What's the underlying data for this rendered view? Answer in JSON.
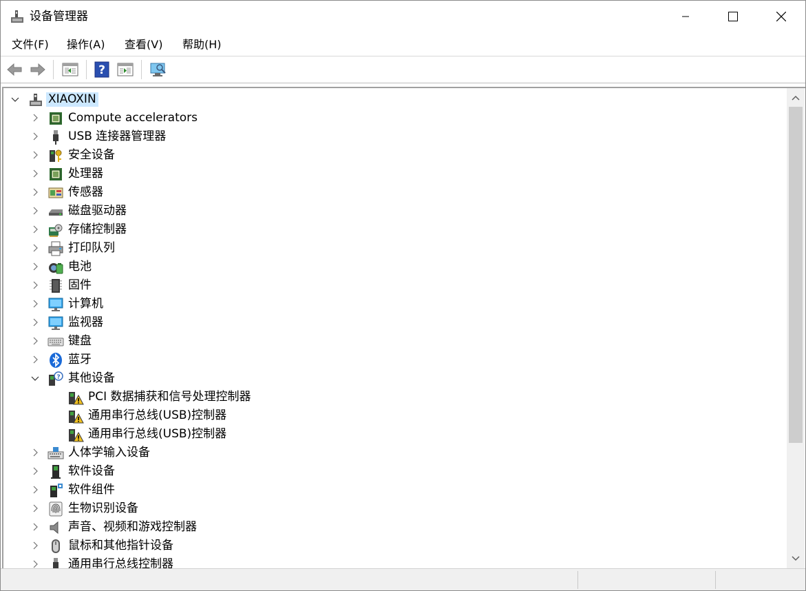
{
  "window": {
    "title": "设备管理器",
    "controls": [
      "minimize",
      "maximize",
      "close"
    ]
  },
  "menubar": {
    "items": [
      "文件(F)",
      "操作(A)",
      "查看(V)",
      "帮助(H)"
    ]
  },
  "toolbar": {
    "buttons": [
      "back-icon",
      "forward-icon",
      "properties-view-icon",
      "help-icon",
      "show-hide-icon",
      "scan-hardware-icon"
    ]
  },
  "tree": {
    "root": "XIAOXIN",
    "items": [
      {
        "label": "Compute accelerators",
        "icon": "chip-icon",
        "expanded": false
      },
      {
        "label": "USB 连接器管理器",
        "icon": "usb-plug-icon",
        "expanded": false
      },
      {
        "label": "安全设备",
        "icon": "security-key-icon",
        "expanded": false
      },
      {
        "label": "处理器",
        "icon": "processor-icon",
        "expanded": false
      },
      {
        "label": "传感器",
        "icon": "sensor-icon",
        "expanded": false
      },
      {
        "label": "磁盘驱动器",
        "icon": "disk-drive-icon",
        "expanded": false
      },
      {
        "label": "存储控制器",
        "icon": "storage-controller-icon",
        "expanded": false
      },
      {
        "label": "打印队列",
        "icon": "printer-icon",
        "expanded": false
      },
      {
        "label": "电池",
        "icon": "battery-icon",
        "expanded": false
      },
      {
        "label": "固件",
        "icon": "firmware-icon",
        "expanded": false
      },
      {
        "label": "计算机",
        "icon": "computer-icon",
        "expanded": false
      },
      {
        "label": "监视器",
        "icon": "monitor-icon",
        "expanded": false
      },
      {
        "label": "键盘",
        "icon": "keyboard-icon",
        "expanded": false
      },
      {
        "label": "蓝牙",
        "icon": "bluetooth-icon",
        "expanded": false
      },
      {
        "label": "其他设备",
        "icon": "other-devices-icon",
        "expanded": true,
        "children": [
          {
            "label": "PCI 数据捕获和信号处理控制器",
            "icon": "warning-device-icon"
          },
          {
            "label": "通用串行总线(USB)控制器",
            "icon": "warning-device-icon"
          },
          {
            "label": "通用串行总线(USB)控制器",
            "icon": "warning-device-icon"
          }
        ]
      },
      {
        "label": "人体学输入设备",
        "icon": "hid-icon",
        "expanded": false
      },
      {
        "label": "软件设备",
        "icon": "software-device-icon",
        "expanded": false
      },
      {
        "label": "软件组件",
        "icon": "software-component-icon",
        "expanded": false
      },
      {
        "label": "生物识别设备",
        "icon": "fingerprint-icon",
        "expanded": false
      },
      {
        "label": "声音、视频和游戏控制器",
        "icon": "speaker-icon",
        "expanded": false
      },
      {
        "label": "鼠标和其他指针设备",
        "icon": "mouse-icon",
        "expanded": false
      },
      {
        "label": "通用串行总线控制器",
        "icon": "usb-icon",
        "expanded": false
      }
    ]
  },
  "colors": {
    "selection": "#cce8ff",
    "scrollbar_track": "#f0f0f0",
    "scrollbar_thumb": "#cdcdcd",
    "status_bar": "#f0f0f0"
  }
}
